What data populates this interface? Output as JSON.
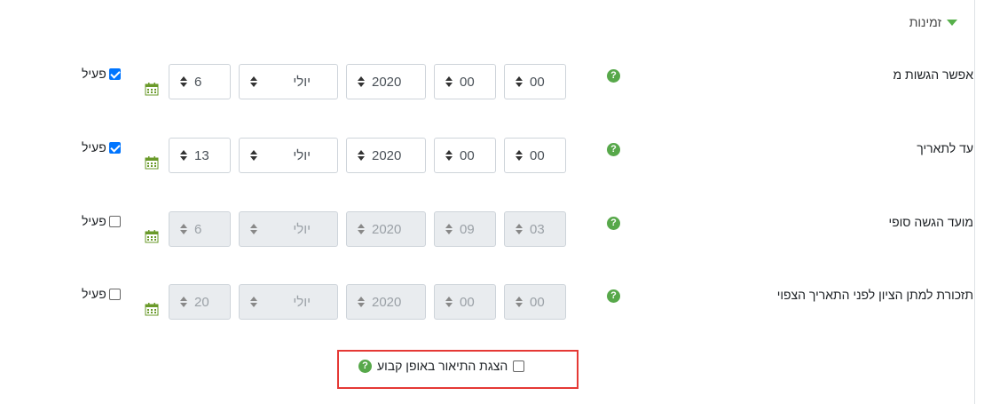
{
  "section": {
    "title": "זמינות"
  },
  "help_glyph": "?",
  "rows": [
    {
      "label": "אפשר הגשות מ",
      "day": "6",
      "month": "יולי",
      "year": "2020",
      "hour": "00",
      "minute": "00",
      "enable_label": "פעיל",
      "enabled": true
    },
    {
      "label": "עד לתאריך",
      "day": "13",
      "month": "יולי",
      "year": "2020",
      "hour": "00",
      "minute": "00",
      "enable_label": "פעיל",
      "enabled": true
    },
    {
      "label": "מועד הגשה סופי",
      "day": "6",
      "month": "יולי",
      "year": "2020",
      "hour": "09",
      "minute": "03",
      "enable_label": "פעיל",
      "enabled": false
    },
    {
      "label": "תזכורת למתן הציון לפני התאריך הצפוי",
      "day": "20",
      "month": "יולי",
      "year": "2020",
      "hour": "00",
      "minute": "00",
      "enable_label": "פעיל",
      "enabled": false
    }
  ],
  "always_show": {
    "label": "הצגת התיאור באופן קבוע",
    "checked": false
  },
  "colors": {
    "help": "#57a84a",
    "checkbox": "#0075ff",
    "highlight": "#e53935",
    "disabled": "#e9ecef"
  }
}
